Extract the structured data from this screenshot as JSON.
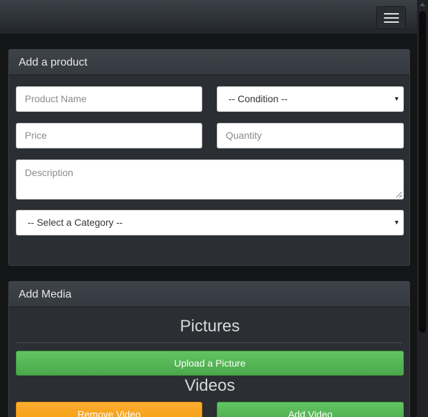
{
  "navbar": {
    "menu_icon": "hamburger-menu-icon"
  },
  "product_panel": {
    "heading": "Add a product",
    "product_name_placeholder": "Product Name",
    "condition_select": "-- Condition --",
    "price_placeholder": "Price",
    "quantity_placeholder": "Quantity",
    "description_placeholder": "Description",
    "category_select": "-- Select a Category --",
    "select_caret_icon": "triangle-down-icon"
  },
  "media_panel": {
    "heading": "Add Media",
    "pictures_title": "Pictures",
    "upload_picture_label": "Upload a Picture",
    "videos_title": "Videos",
    "remove_video_label": "Remove Video",
    "add_video_label": "Add Video"
  },
  "colors": {
    "success": "#5cb85c",
    "warning": "#f89406",
    "panel_background": "#2b2e32"
  }
}
